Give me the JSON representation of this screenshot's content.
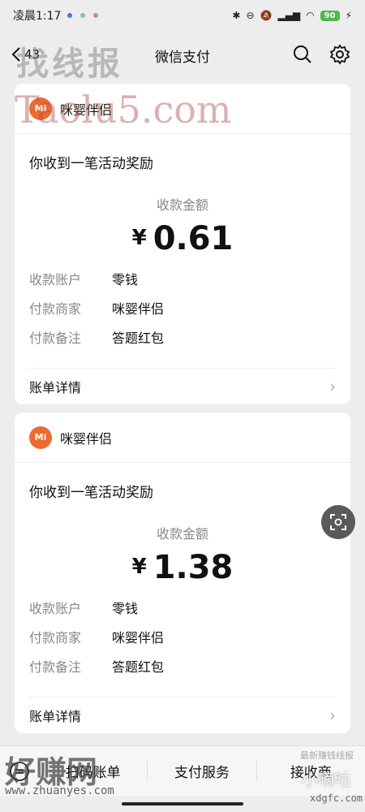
{
  "status_bar": {
    "time": "凌晨1:17",
    "battery": "90"
  },
  "nav": {
    "back_count": "43",
    "title": "微信支付"
  },
  "cards": [
    {
      "merchant": "咪婴伴侣",
      "logo_text": "Mi",
      "notice": "你收到一笔活动奖励",
      "amount_label": "收款金额",
      "currency": "¥",
      "amount": "0.61",
      "details": [
        {
          "key": "收款账户",
          "value": "零钱"
        },
        {
          "key": "付款商家",
          "value": "咪婴伴侣"
        },
        {
          "key": "付款备注",
          "value": "答题红包"
        }
      ],
      "bill_label": "账单详情"
    },
    {
      "merchant": "咪婴伴侣",
      "logo_text": "Mi",
      "notice": "你收到一笔活动奖励",
      "amount_label": "收款金额",
      "currency": "¥",
      "amount": "1.38",
      "details": [
        {
          "key": "收款账户",
          "value": "零钱"
        },
        {
          "key": "付款商家",
          "value": "咪婴伴侣"
        },
        {
          "key": "付款备注",
          "value": "答题红包"
        }
      ],
      "bill_label": "账单详情"
    }
  ],
  "bottom_bar": {
    "items": [
      "扫码账单",
      "支付服务",
      "接收商"
    ]
  },
  "watermarks": {
    "top": "找线报",
    "top_latin": "Taolu5.com",
    "bottom_left": "好赚网",
    "bottom_left_url": "www.zhuanyes.com",
    "bottom_right_small": "最新赚钱线报",
    "bottom_right": "小嘀咕",
    "bottom_right_url": "xdgfc.com"
  },
  "colors": {
    "accent": "#07c160",
    "logo": "#ef6a2c",
    "background": "#ededed"
  }
}
